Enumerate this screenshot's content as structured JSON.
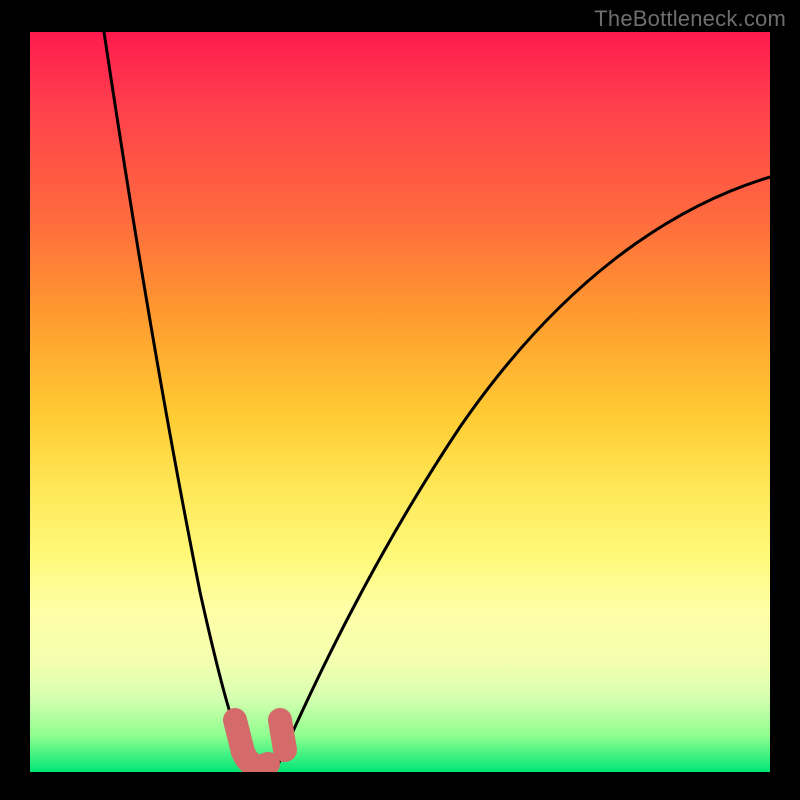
{
  "watermark": "TheBottleneck.com",
  "chart_data": {
    "type": "line",
    "title": "",
    "xlabel": "",
    "ylabel": "",
    "xlim": [
      0,
      100
    ],
    "ylim": [
      0,
      100
    ],
    "grid": false,
    "series": [
      {
        "name": "left-branch",
        "x": [
          10,
          12,
          14,
          16,
          18,
          20,
          22,
          24,
          26,
          28,
          29.5
        ],
        "y": [
          100,
          90,
          80,
          68,
          56,
          44,
          33,
          22,
          12,
          4,
          0
        ]
      },
      {
        "name": "right-branch",
        "x": [
          33,
          35,
          38,
          42,
          47,
          53,
          60,
          68,
          77,
          88,
          100
        ],
        "y": [
          0,
          4,
          10,
          18,
          27,
          36,
          45,
          54,
          63,
          72,
          80
        ]
      }
    ],
    "annotations": [
      {
        "name": "trough-marker",
        "shape": "U",
        "approx_x_range": [
          27,
          34
        ],
        "approx_y_range": [
          0,
          6
        ],
        "color": "#d46a6a"
      }
    ]
  }
}
